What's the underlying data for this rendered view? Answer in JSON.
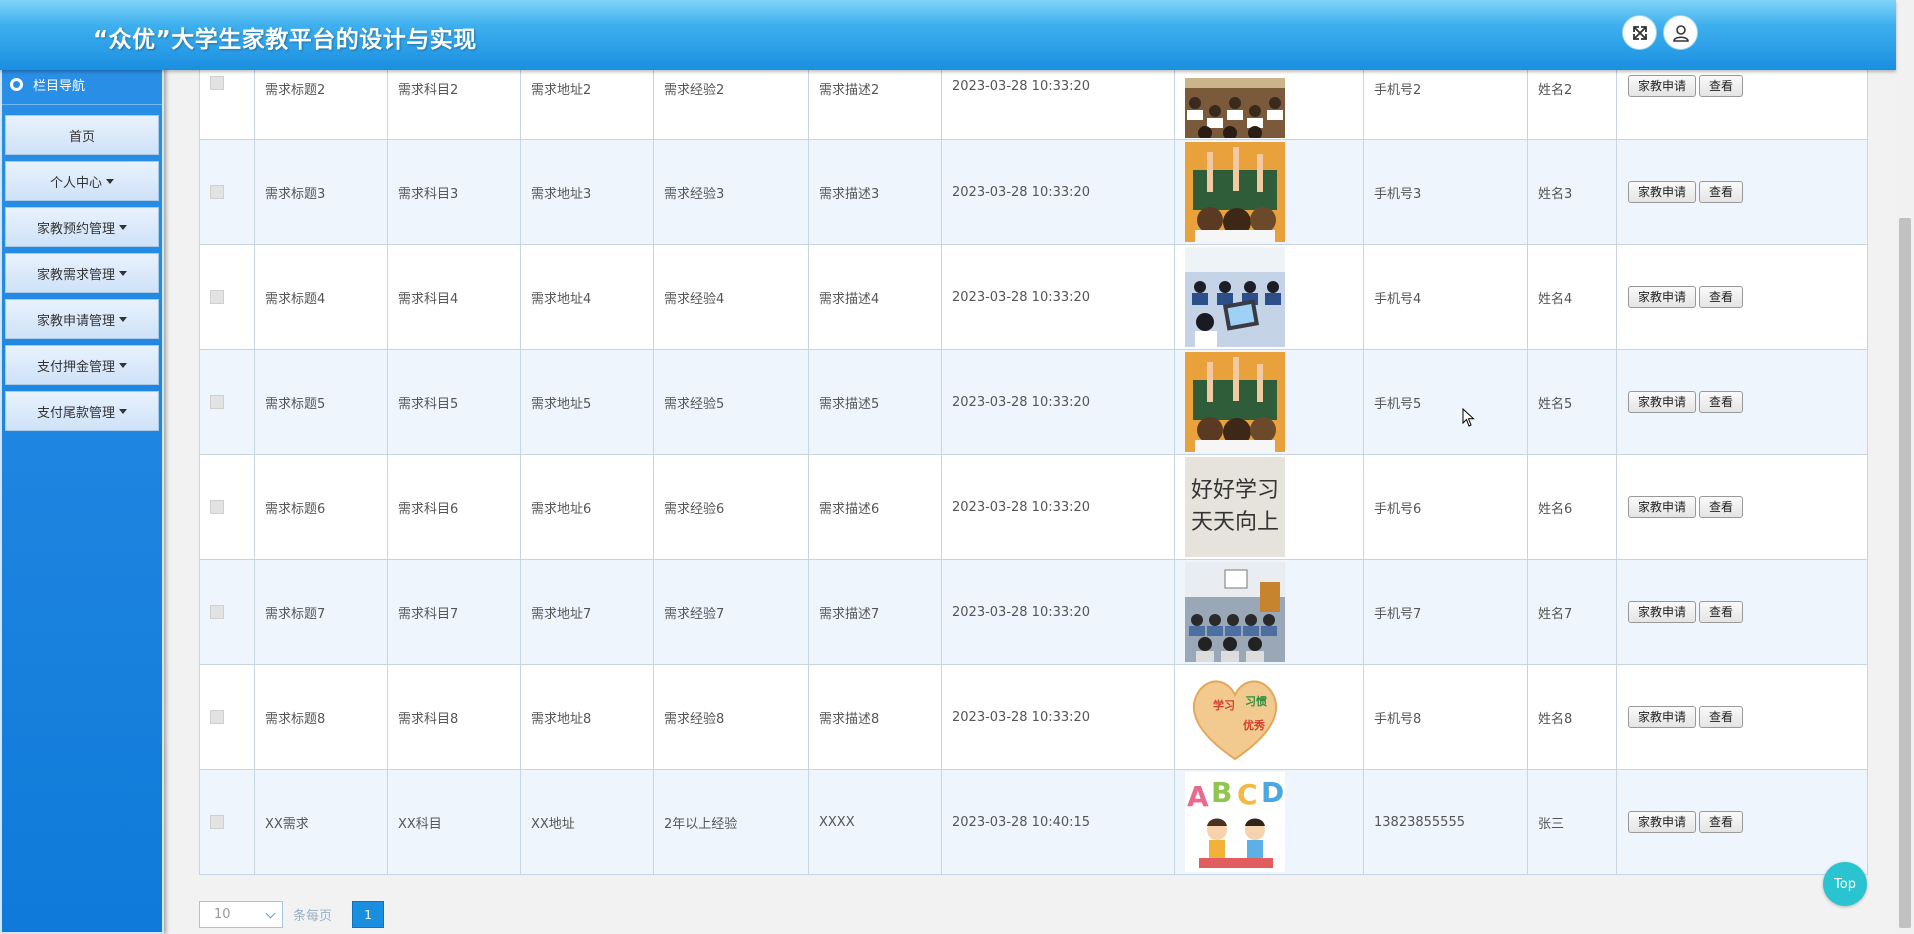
{
  "header": {
    "title": "“众优”大学生家教平台的设计与实现",
    "fullscreen_icon": "fullscreen-icon",
    "user_icon": "user-icon"
  },
  "sidebar": {
    "title": "栏目导航",
    "items": [
      {
        "label": "首页",
        "dropdown": false
      },
      {
        "label": "个人中心",
        "dropdown": true
      },
      {
        "label": "家教预约管理",
        "dropdown": true
      },
      {
        "label": "家教需求管理",
        "dropdown": true
      },
      {
        "label": "家教申请管理",
        "dropdown": true
      },
      {
        "label": "支付押金管理",
        "dropdown": true
      },
      {
        "label": "支付尾款管理",
        "dropdown": true
      }
    ]
  },
  "table": {
    "rows": [
      {
        "title": "需求标题2",
        "subject": "需求科目2",
        "address": "需求地址2",
        "experience": "需求经验2",
        "description": "需求描述2",
        "time": "2023-03-28 10:33:20",
        "image": "classroom-students",
        "phone": "手机号2",
        "name": "姓名2",
        "apply": "家教申请",
        "view": "查看"
      },
      {
        "title": "需求标题3",
        "subject": "需求科目3",
        "address": "需求地址3",
        "experience": "需求经验3",
        "description": "需求描述3",
        "time": "2023-03-28 10:33:20",
        "image": "raised-hands-blackboard",
        "phone": "手机号3",
        "name": "姓名3",
        "apply": "家教申请",
        "view": "查看"
      },
      {
        "title": "需求标题4",
        "subject": "需求科目4",
        "address": "需求地址4",
        "experience": "需求经验4",
        "description": "需求描述4",
        "time": "2023-03-28 10:33:20",
        "image": "computer-classroom",
        "phone": "手机号4",
        "name": "姓名4",
        "apply": "家教申请",
        "view": "查看"
      },
      {
        "title": "需求标题5",
        "subject": "需求科目5",
        "address": "需求地址5",
        "experience": "需求经验5",
        "description": "需求描述5",
        "time": "2023-03-28 10:33:20",
        "image": "raised-hands-blackboard",
        "phone": "手机号5",
        "name": "姓名5",
        "apply": "家教申请",
        "view": "查看"
      },
      {
        "title": "需求标题6",
        "subject": "需求科目6",
        "address": "需求地址6",
        "experience": "需求经验6",
        "description": "需求描述6",
        "time": "2023-03-28 10:33:20",
        "image": "handwriting-study",
        "phone": "手机号6",
        "name": "姓名6",
        "apply": "家教申请",
        "view": "查看"
      },
      {
        "title": "需求标题7",
        "subject": "需求科目7",
        "address": "需求地址7",
        "experience": "需求经验7",
        "description": "需求描述7",
        "time": "2023-03-28 10:33:20",
        "image": "lecture-room",
        "phone": "手机号7",
        "name": "姓名7",
        "apply": "家教申请",
        "view": "查看"
      },
      {
        "title": "需求标题8",
        "subject": "需求科目8",
        "address": "需求地址8",
        "experience": "需求经验8",
        "description": "需求描述8",
        "time": "2023-03-28 10:33:20",
        "image": "study-heart",
        "phone": "手机号8",
        "name": "姓名8",
        "apply": "家教申请",
        "view": "查看"
      },
      {
        "title": "XX需求",
        "subject": "XX科目",
        "address": "XX地址",
        "experience": "2年以上经验",
        "description": "XXXX",
        "time": "2023-03-28 10:40:15",
        "image": "abcd-kids",
        "phone": "13823855555",
        "name": "张三",
        "apply": "家教申请",
        "view": "查看"
      }
    ]
  },
  "pagination": {
    "page_size": "10",
    "per_page_label": "条每页",
    "current_page": "1"
  },
  "top_button": "Top",
  "colors": {
    "header": "#1a8fe0",
    "sidebar": "#0f7ad9",
    "row_alt": "#eef5fd",
    "top_button": "#29c4cf"
  }
}
